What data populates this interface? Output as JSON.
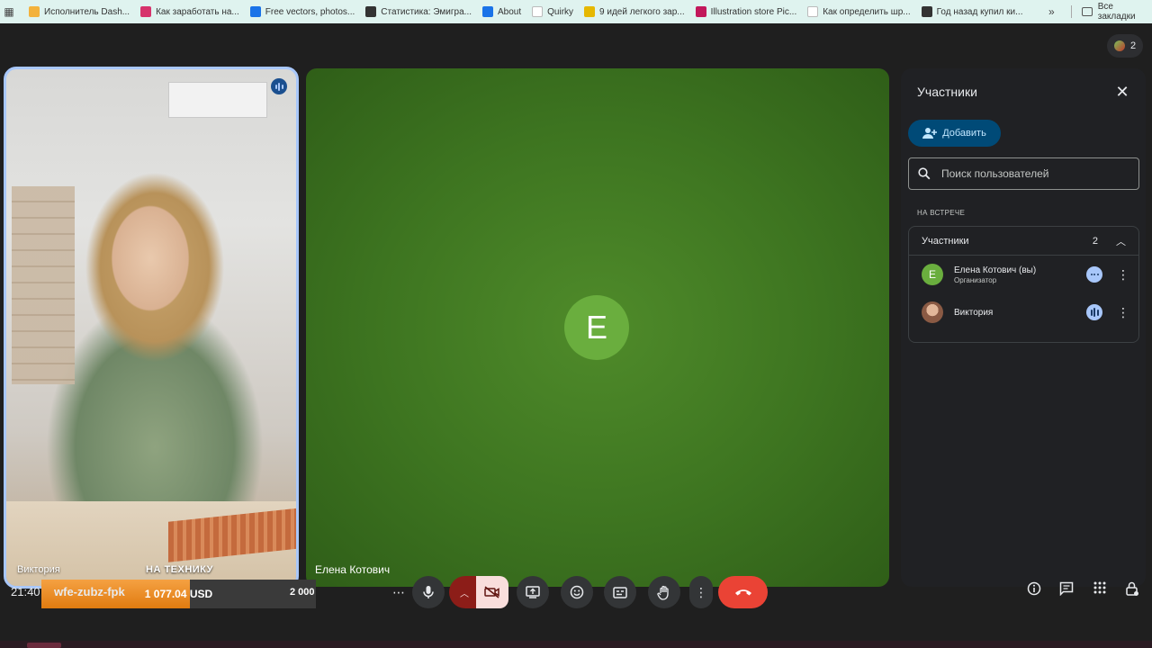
{
  "bookmarks": [
    {
      "label": "Исполнитель Dash...",
      "color": "#f3b23c"
    },
    {
      "label": "Как заработать на...",
      "color": "#d6336c"
    },
    {
      "label": "Free vectors, photos...",
      "color": "#1a73e8"
    },
    {
      "label": "Статистика: Эмигра...",
      "color": "#333333"
    },
    {
      "label": "About",
      "color": "#1a73e8"
    },
    {
      "label": "Quirky",
      "color": "#ffffff"
    },
    {
      "label": "9 идей легкого зар...",
      "color": "#e6b800"
    },
    {
      "label": "Illustration store Pic...",
      "color": "#c2185b"
    },
    {
      "label": "Как определить шр...",
      "color": "#ffffff"
    },
    {
      "label": "Год назад купил ки...",
      "color": "#333333"
    }
  ],
  "bookmarks_all": "Все закладки",
  "participant_badge": {
    "count": "2"
  },
  "self_tile": {
    "name": "Виктория",
    "overlay_text": "НА ТЕХНИКУ"
  },
  "donation": {
    "amount": "1 077.04",
    "currency": "USD",
    "goal": "2 000",
    "progress_fraction": 0.54
  },
  "main_tile": {
    "initial": "E",
    "name": "Елена Котович",
    "bg_color": "#3d7420",
    "avatar_color": "#6aae3e"
  },
  "panel": {
    "title": "Участники",
    "add_label": "Добавить",
    "search_placeholder": "Поиск пользователей",
    "section_label": "НА ВСТРЕЧЕ",
    "group_label": "Участники",
    "group_count": "2",
    "people": [
      {
        "initial": "E",
        "name": "Елена Котович (вы)",
        "role": "Организатор",
        "avatar_color": "#6aae3e"
      },
      {
        "initial": "",
        "name": "Виктория",
        "role": "",
        "avatar_color": "#8a5a44"
      }
    ]
  },
  "bottom": {
    "clock": "21:40",
    "meeting_code": "wfe-zubz-fpk"
  },
  "colors": {
    "accent": "#a8c7fa",
    "hangup": "#ea4335",
    "camera_off": "#f9dedc"
  }
}
